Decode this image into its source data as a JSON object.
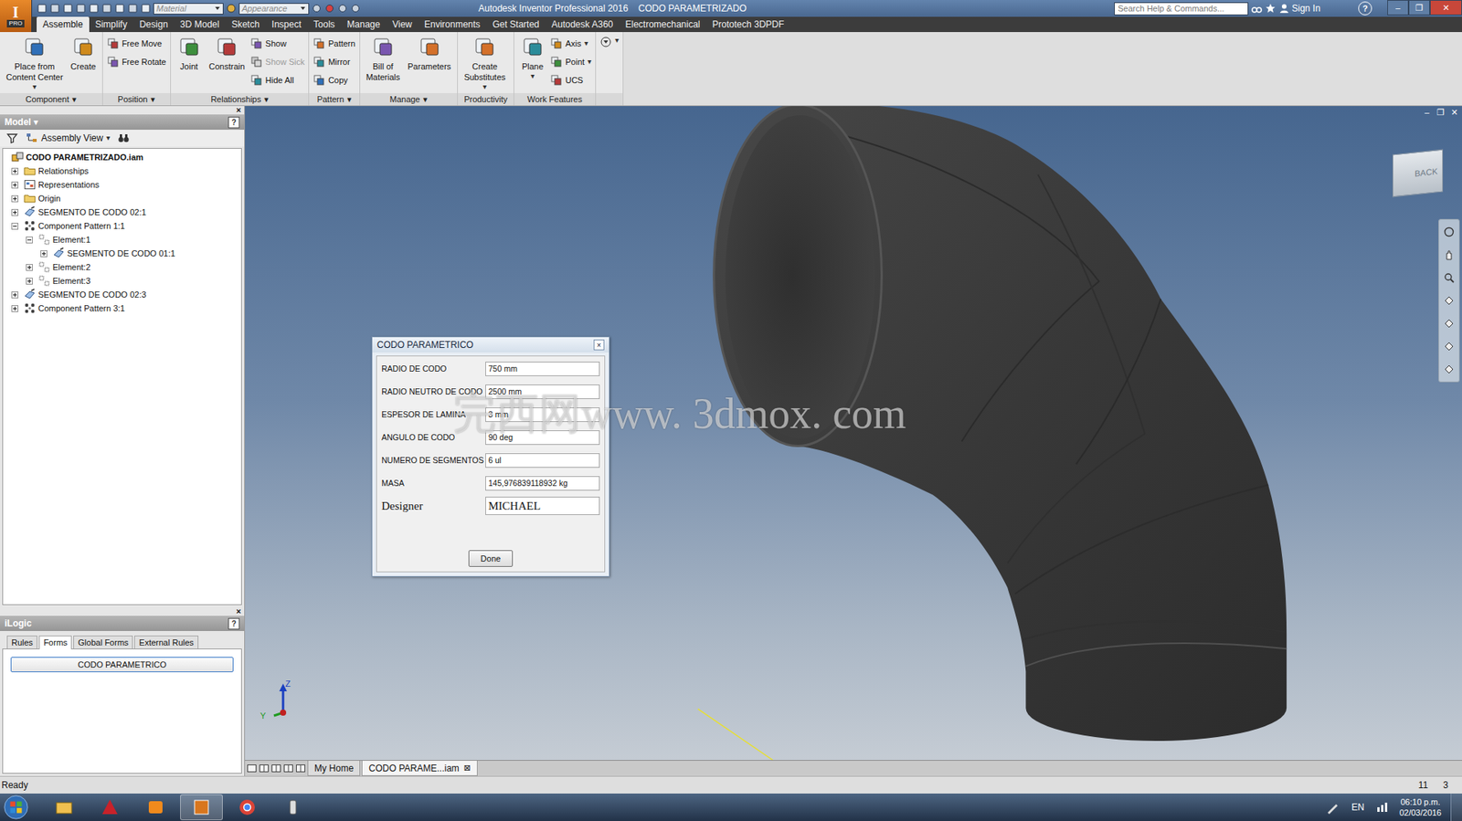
{
  "window": {
    "title": "Autodesk Inventor Professional 2016    CODO PARAMETRIZADO",
    "logo": "I",
    "logo_badge": "PRO",
    "controls": [
      "–",
      "❐",
      "✕"
    ]
  },
  "quick_access": {
    "material": "Material",
    "appearance": "Appearance"
  },
  "search": {
    "placeholder": "Search Help & Commands..."
  },
  "sign_in": "Sign In",
  "help": "?",
  "ribbon_tabs": [
    {
      "label": "Assemble",
      "selected": true
    },
    {
      "label": "Simplify",
      "selected": false
    },
    {
      "label": "Design",
      "selected": false
    },
    {
      "label": "3D Model",
      "selected": false
    },
    {
      "label": "Sketch",
      "selected": false
    },
    {
      "label": "Inspect",
      "selected": false
    },
    {
      "label": "Tools",
      "selected": false
    },
    {
      "label": "Manage",
      "selected": false
    },
    {
      "label": "View",
      "selected": false
    },
    {
      "label": "Environments",
      "selected": false
    },
    {
      "label": "Get Started",
      "selected": false
    },
    {
      "label": "Autodesk A360",
      "selected": false
    },
    {
      "label": "Electromechanical",
      "selected": false
    },
    {
      "label": "Prototech 3DPDF",
      "selected": false
    }
  ],
  "ribbon_groups": [
    {
      "label": "Component",
      "arrow": "▾",
      "columns": [
        {
          "kind": "large",
          "buttons": [
            {
              "lines": [
                "Place from",
                "Content Center"
              ],
              "arrow": "▾",
              "disabled": false
            }
          ]
        },
        {
          "kind": "large",
          "buttons": [
            {
              "lines": [
                "Create"
              ],
              "arrow": "",
              "disabled": false
            }
          ]
        }
      ]
    },
    {
      "label": "Position",
      "arrow": "▾",
      "columns": [
        {
          "kind": "small",
          "buttons": [
            {
              "lines": [
                "Free Move"
              ],
              "arrow": "",
              "disabled": false
            },
            {
              "lines": [
                "Free Rotate"
              ],
              "arrow": "",
              "disabled": false
            }
          ]
        }
      ]
    },
    {
      "label": "Relationships",
      "arrow": "▾",
      "columns": [
        {
          "kind": "large",
          "buttons": [
            {
              "lines": [
                "Joint"
              ],
              "arrow": "",
              "disabled": false
            }
          ]
        },
        {
          "kind": "large",
          "buttons": [
            {
              "lines": [
                "Constrain"
              ],
              "arrow": "",
              "disabled": false
            }
          ]
        },
        {
          "kind": "small",
          "buttons": [
            {
              "lines": [
                "Show"
              ],
              "arrow": "",
              "disabled": false
            },
            {
              "lines": [
                "Show Sick"
              ],
              "arrow": "",
              "disabled": true
            },
            {
              "lines": [
                "Hide All"
              ],
              "arrow": "",
              "disabled": false
            }
          ]
        }
      ]
    },
    {
      "label": "Pattern",
      "arrow": "▾",
      "columns": [
        {
          "kind": "small",
          "buttons": [
            {
              "lines": [
                "Pattern"
              ],
              "arrow": "",
              "disabled": false
            },
            {
              "lines": [
                "Mirror"
              ],
              "arrow": "",
              "disabled": false
            },
            {
              "lines": [
                "Copy"
              ],
              "arrow": "",
              "disabled": false
            }
          ]
        }
      ]
    },
    {
      "label": "Manage",
      "arrow": "▾",
      "columns": [
        {
          "kind": "large",
          "buttons": [
            {
              "lines": [
                "Bill of",
                "Materials"
              ],
              "arrow": "",
              "disabled": false
            }
          ]
        },
        {
          "kind": "large",
          "buttons": [
            {
              "lines": [
                "Parameters"
              ],
              "arrow": "",
              "disabled": false
            }
          ]
        }
      ]
    },
    {
      "label": "Productivity",
      "arrow": "",
      "columns": [
        {
          "kind": "large",
          "buttons": [
            {
              "lines": [
                "Create",
                "Substitutes"
              ],
              "arrow": "▾",
              "disabled": false
            }
          ]
        }
      ]
    },
    {
      "label": "Work Features",
      "arrow": "",
      "columns": [
        {
          "kind": "large",
          "buttons": [
            {
              "lines": [
                "Plane"
              ],
              "arrow": "▾",
              "disabled": false
            }
          ]
        },
        {
          "kind": "small",
          "buttons": [
            {
              "lines": [
                "Axis"
              ],
              "arrow": "▾",
              "disabled": false
            },
            {
              "lines": [
                "Point"
              ],
              "arrow": "▾",
              "disabled": false
            },
            {
              "lines": [
                "UCS"
              ],
              "arrow": "",
              "disabled": false
            }
          ]
        }
      ]
    }
  ],
  "ribbon_extra": "▾",
  "browser": {
    "close": "×",
    "title": "Model",
    "arrow": "▾",
    "help": "?",
    "view": "Assembly View",
    "view_arrow": "▾",
    "tree": [
      {
        "label": "CODO PARAMETRIZADO.iam",
        "level": 0,
        "kind": "assembly"
      },
      {
        "label": "Relationships",
        "level": 1,
        "kind": "folder",
        "expanded": false
      },
      {
        "label": "Representations",
        "level": 1,
        "kind": "representations",
        "expanded": false
      },
      {
        "label": "Origin",
        "level": 1,
        "kind": "folder",
        "expanded": false
      },
      {
        "label": "SEGMENTO DE CODO 02:1",
        "level": 1,
        "kind": "part",
        "expanded": false
      },
      {
        "label": "Component Pattern 1:1",
        "level": 1,
        "kind": "pattern",
        "expanded": true
      },
      {
        "label": "Element:1",
        "level": 2,
        "kind": "element",
        "expanded": true
      },
      {
        "label": "SEGMENTO DE CODO 01:1",
        "level": 3,
        "kind": "part",
        "expanded": false
      },
      {
        "label": "Element:2",
        "level": 2,
        "kind": "element",
        "expanded": false
      },
      {
        "label": "Element:3",
        "level": 2,
        "kind": "element",
        "expanded": false
      },
      {
        "label": "SEGMENTO DE CODO 02:3",
        "level": 1,
        "kind": "part",
        "expanded": false
      },
      {
        "label": "Component Pattern 3:1",
        "level": 1,
        "kind": "pattern",
        "expanded": false
      }
    ]
  },
  "ilogic": {
    "close": "×",
    "title": "iLogic",
    "help": "?",
    "tabs": [
      {
        "label": "Rules",
        "selected": false
      },
      {
        "label": "Forms",
        "selected": true
      },
      {
        "label": "Global Forms",
        "selected": false
      },
      {
        "label": "External Rules",
        "selected": false
      }
    ],
    "buttons": [
      "CODO PARAMETRICO"
    ]
  },
  "dialog": {
    "title": "CODO PARAMETRICO",
    "close": "×",
    "fields": [
      {
        "label": "RADIO DE CODO",
        "value": "750 mm",
        "kind": "text"
      },
      {
        "label": "RADIO NEUTRO DE CODO",
        "value": "2500 mm",
        "kind": "text"
      },
      {
        "label": "ESPESOR DE LAMINA",
        "value": "3 mm",
        "kind": "text"
      },
      {
        "label": "ANGULO DE CODO",
        "value": "90 deg",
        "kind": "text"
      },
      {
        "label": "NUMERO DE SEGMENTOS",
        "value": "6 ul",
        "kind": "text"
      },
      {
        "label": "MASA",
        "value": "145,976839118932 kg",
        "kind": "text"
      },
      {
        "label": "Designer",
        "value": "MICHAEL",
        "kind": "designer"
      }
    ],
    "button": "Done"
  },
  "viewport": {
    "viewcube": "BACK",
    "axes": [
      "Z",
      "Y"
    ],
    "watermark": "完西网www. 3dmox. com",
    "controls": [
      "–",
      "❐",
      "✕"
    ]
  },
  "doc_tabs": [
    {
      "label": "My Home",
      "selected": false,
      "close": ""
    },
    {
      "label": "CODO PARAME...iam",
      "selected": true,
      "close": "⊠"
    }
  ],
  "status_bar": {
    "text": "Ready",
    "counts": [
      "11",
      "3"
    ]
  },
  "taskbar": {
    "language": "EN",
    "time": "06:10 p.m.",
    "date": "02/03/2016"
  }
}
